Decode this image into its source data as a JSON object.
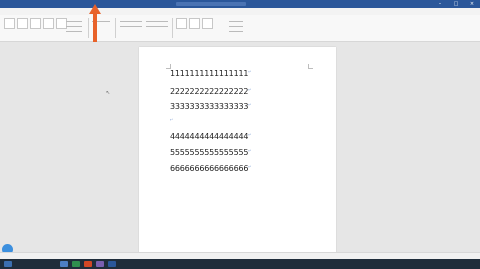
{
  "document": {
    "lines": [
      {
        "text": "1111111111111111"
      },
      {
        "text": "2222222222222222"
      },
      {
        "text": "3333333333333333"
      },
      {
        "text": ""
      },
      {
        "text": "4444444444444444"
      },
      {
        "text": "5555555555555555"
      },
      {
        "text": "6666666666666666"
      }
    ]
  },
  "colors": {
    "brand": "#2b579a",
    "arrow": "#e8622a",
    "taskbar": "#1f2d3b"
  },
  "icons": [
    "paragraph-mark-icon",
    "pointer-cursor-icon",
    "cortana-icon",
    "minimize-icon",
    "maximize-icon",
    "close-icon"
  ]
}
